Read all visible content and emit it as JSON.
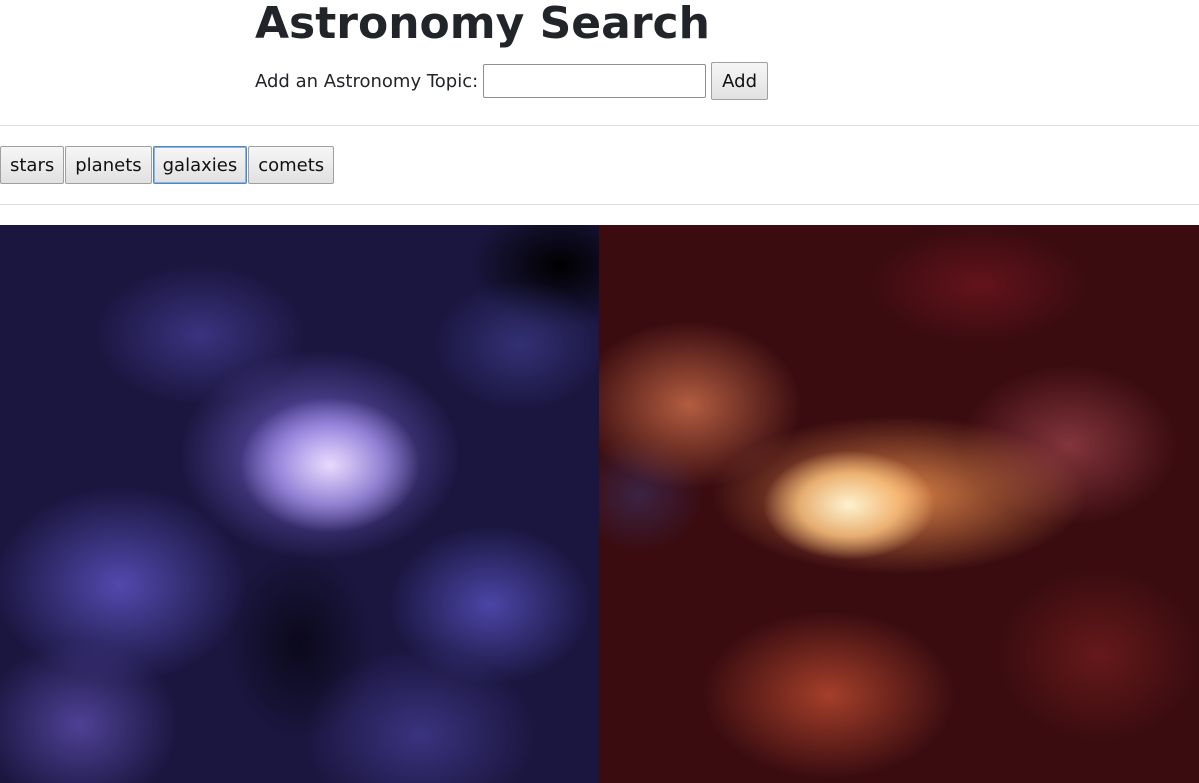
{
  "header": {
    "title": "Astronomy Search",
    "add_label": "Add an Astronomy Topic:",
    "input_value": "",
    "input_placeholder": "",
    "add_button_label": "Add"
  },
  "topics": [
    {
      "label": "stars"
    },
    {
      "label": "planets"
    },
    {
      "label": "galaxies",
      "focused": true
    },
    {
      "label": "comets"
    }
  ],
  "gallery": [
    {
      "description_icon": "nebula-purple-image"
    },
    {
      "description_icon": "nebula-orange-image"
    }
  ]
}
